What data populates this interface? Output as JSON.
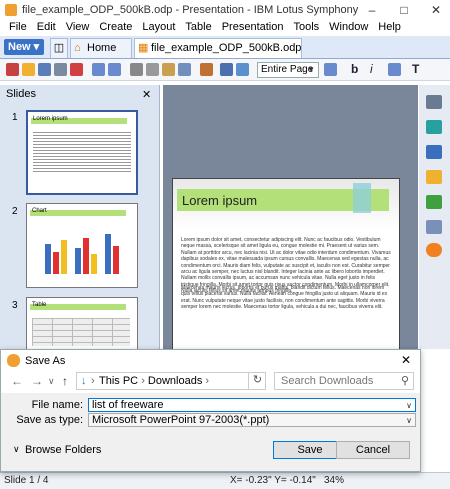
{
  "window": {
    "title": "file_example_ODP_500kB.odp - Presentation - IBM Lotus Symphony"
  },
  "menu": [
    "File",
    "Edit",
    "View",
    "Create",
    "Layout",
    "Table",
    "Presentation",
    "Tools",
    "Window",
    "Help"
  ],
  "tabs": {
    "new_label": "New",
    "home_label": "Home",
    "doc_label": "file_example_ODP_500kB.odp"
  },
  "toolbar": {
    "zoom_mode": "Entire Page"
  },
  "slides_panel": {
    "header": "Slides",
    "thumbs": [
      {
        "num": "1",
        "title": "Lorem ipsum"
      },
      {
        "num": "2",
        "title": "Chart"
      },
      {
        "num": "3",
        "title": "Table"
      }
    ]
  },
  "slide": {
    "title": "Lorem ipsum",
    "para1": "Lorem ipsum dolor sit amet, consectetur adipiscing elit. Nunc ac faucibus odio. Vestibulum neque massa, scelerisque sit amet ligula eu, congue molestie mi. Praesent ut varius sem. Nullam at porttitor arcu, nec lacinia nisi. Ut ac dolor vitae odio interdum condimentum. Vivamus dapibus sodales ex, vitae malesuada ipsum cursus convallis. Maecenas sed egestas nulla, ac condimentum orci. Mauris diam felis, vulputate ac suscipit et, iaculis non est. Curabitur semper arcu ac ligula semper, nec luctus nisl blandit. Integer lacinia ante ac libero lobortis imperdiet. Nullam mollis convallis ipsum, ac accumsan nunc vehicula vitae. Nulla eget justo in felis tristique fringilla. Morbi sit amet tortor quis risus auctor condimentum. Morbi in ullamcorper elit. Nulla iaculis tellus sit amet mauris tempus fringilla.",
    "para2": "Maecenas mauris lectus, lobortis et purus mattis, blandit dictum tellus. Maecenas non lorem quis tellus placerat varius. Nulla facilisi. Aenean congue fringilla justo ut aliquam. Mauris id ex erat. Nunc vulputate neque vitae justo facilisis, non condimentum ante sagittis. Morbi viverra semper lorem nec molestie. Maecenas tortor ligula, vehicula a dui nec, faucibus viverra elit."
  },
  "dialog": {
    "title": "Save As",
    "breadcrumb": [
      "This PC",
      "Downloads"
    ],
    "search_placeholder": "Search Downloads",
    "file_name_label": "File name:",
    "file_name_value": "list of freeware",
    "save_type_label": "Save as type:",
    "save_type_value": "Microsoft PowerPoint 97-2003(*.ppt)",
    "browse_label": "Browse Folders",
    "save_label": "Save",
    "cancel_label": "Cancel"
  },
  "status": {
    "slide": "Slide 1 / 4",
    "coords": "X= -0.23\"  Y= -0.14\"",
    "zoom": "34%"
  },
  "colors": {
    "accent": "#3a72c8",
    "slide_title_bg": "#b4e07a",
    "canvas_bg": "#7a8699"
  }
}
